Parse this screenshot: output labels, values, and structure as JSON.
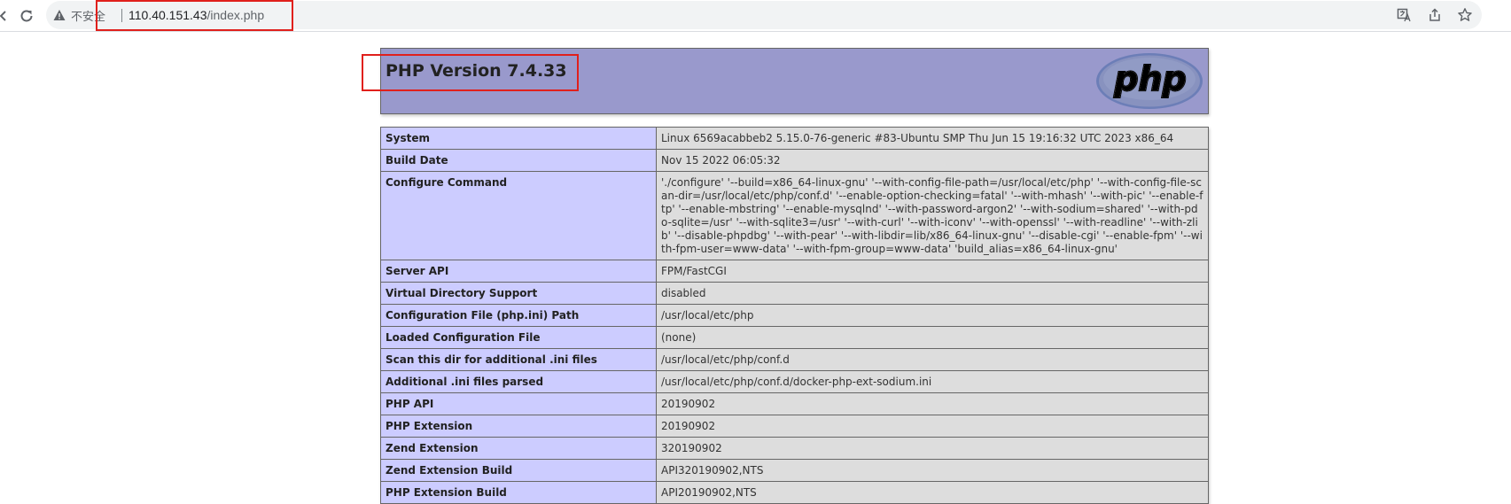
{
  "browser": {
    "security_label": "不安全",
    "url_host": "110.40.151.43",
    "url_path": "/index.php",
    "icons": [
      "back-icon",
      "reload-icon",
      "warning-icon",
      "translate-icon",
      "share-icon",
      "bookmark-star-icon"
    ]
  },
  "colors": {
    "annotation": "#e0201c",
    "header_bg": "#9999cc",
    "label_bg": "#ccccff",
    "value_bg": "#dddddd"
  },
  "php": {
    "title": "PHP Version 7.4.33",
    "logo_text": "php"
  },
  "rows": [
    {
      "label": "System",
      "value": "Linux 6569acabbeb2 5.15.0-76-generic #83-Ubuntu SMP Thu Jun 15 19:16:32 UTC 2023 x86_64"
    },
    {
      "label": "Build Date",
      "value": "Nov 15 2022 06:05:32"
    },
    {
      "label": "Configure Command",
      "value": "'./configure' '--build=x86_64-linux-gnu' '--with-config-file-path=/usr/local/etc/php' '--with-config-file-scan-dir=/usr/local/etc/php/conf.d' '--enable-option-checking=fatal' '--with-mhash' '--with-pic' '--enable-ftp' '--enable-mbstring' '--enable-mysqlnd' '--with-password-argon2' '--with-sodium=shared' '--with-pdo-sqlite=/usr' '--with-sqlite3=/usr' '--with-curl' '--with-iconv' '--with-openssl' '--with-readline' '--with-zlib' '--disable-phpdbg' '--with-pear' '--with-libdir=lib/x86_64-linux-gnu' '--disable-cgi' '--enable-fpm' '--with-fpm-user=www-data' '--with-fpm-group=www-data' 'build_alias=x86_64-linux-gnu'"
    },
    {
      "label": "Server API",
      "value": "FPM/FastCGI"
    },
    {
      "label": "Virtual Directory Support",
      "value": "disabled"
    },
    {
      "label": "Configuration File (php.ini) Path",
      "value": "/usr/local/etc/php"
    },
    {
      "label": "Loaded Configuration File",
      "value": "(none)"
    },
    {
      "label": "Scan this dir for additional .ini files",
      "value": "/usr/local/etc/php/conf.d"
    },
    {
      "label": "Additional .ini files parsed",
      "value": "/usr/local/etc/php/conf.d/docker-php-ext-sodium.ini"
    },
    {
      "label": "PHP API",
      "value": "20190902"
    },
    {
      "label": "PHP Extension",
      "value": "20190902"
    },
    {
      "label": "Zend Extension",
      "value": "320190902"
    },
    {
      "label": "Zend Extension Build",
      "value": "API320190902,NTS"
    },
    {
      "label": "PHP Extension Build",
      "value": "API20190902,NTS"
    }
  ]
}
